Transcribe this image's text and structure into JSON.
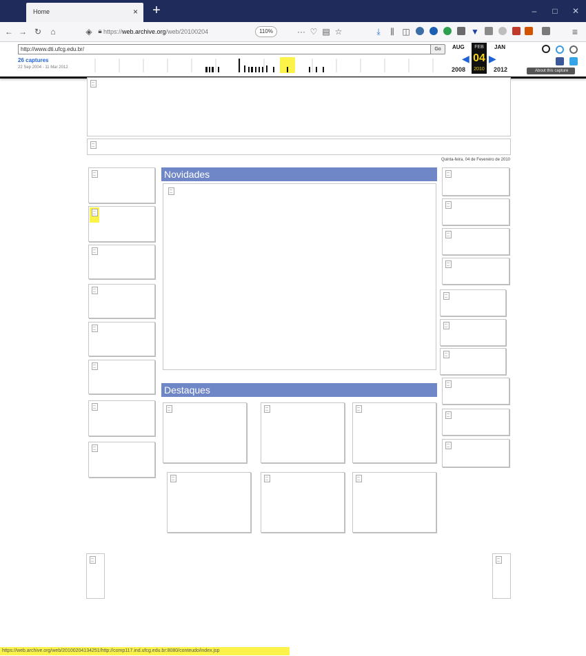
{
  "browser": {
    "tab_title": "Home",
    "tab_close": "×",
    "new_tab": "+",
    "window_buttons": [
      "–",
      "□",
      "✕"
    ],
    "url_prefix": "https://",
    "url_domain": "web.archive.org",
    "url_path": "/web/20100204",
    "zoom": "110%",
    "menu_dots": "···",
    "hamburger": "≡"
  },
  "wayback": {
    "url_value": "http://www.dti.ufcg.edu.br/",
    "go_label": "Go",
    "captures_label": "26 captures",
    "date_range": "22 Sep 2004 - 11 Mar 2012",
    "prev_month": "AUG",
    "current_month": "FEB",
    "next_month": "JAN",
    "day": "04",
    "prev_year": "2008",
    "current_year": "2010",
    "next_year": "2012",
    "about_label": "About this capture"
  },
  "page": {
    "date_text": "Quinta-feira, 04 de Fevereiro de 2010",
    "novidades_title": "Novidades",
    "destaques_title": "Destaques"
  },
  "status_bar": {
    "link_url": "https://web.archive.org/web/20100204134251/http://comp117.ind.ufcg.edu.br:8080/conteudo/index.jsp"
  },
  "colors": {
    "section_header": "#6f86c7",
    "highlight": "#fbf24a",
    "wayback_link": "#1f62d8"
  }
}
